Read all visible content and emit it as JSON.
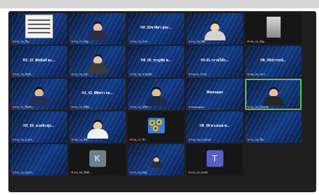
{
  "tiles": [
    {
      "name": "H3_10_student",
      "label": "H3_10_สื่อ...",
      "type": "picture"
    },
    {
      "name": "H3_07_student",
      "label": "H3_07_ณัฐ...",
      "type": "person",
      "skin": "#e7c0a2",
      "hair": "#1a1a1a",
      "shirt": "#2c2c44"
    },
    {
      "name": "H4_02_student",
      "label": "H4_02_ชาล...",
      "type": "name",
      "center": "H4_02ชาลิสา อุทะ..."
    },
    {
      "name": "H4_05_student",
      "label": "H4_05_ศศิ...",
      "type": "person",
      "skin": "#efd1bc",
      "hair": "#2b2018",
      "shirt": "#d8d2cc",
      "bg": "light"
    },
    {
      "name": "H6_05_student",
      "label": "H6_05_มัญ...",
      "type": "photo"
    },
    {
      "name": "H3_10b_student",
      "label": "H3_10_พัชนิ...",
      "type": "name",
      "center": "H3_10_พัชนันท์ ยะ..."
    },
    {
      "name": "H2_05_student",
      "label": "H2_05_สุภั...",
      "type": "person",
      "skin": "#e8c4a8",
      "hair": "#1f1f1f",
      "shirt": "#3b3b3b"
    },
    {
      "name": "H8_06_student",
      "label": "H8_06_ชาญชัย",
      "type": "name",
      "center": "H8_06_ชาญชัย พ..."
    },
    {
      "name": "H3_01_student",
      "label": "H3-01-วราพ...",
      "type": "name",
      "center": "H3-01-วราพโค้ก..."
    },
    {
      "name": "H6_09_student",
      "label": "H6_09_ปรา...",
      "type": "name",
      "center": "H6_09ปรารถน์..."
    },
    {
      "name": "H1_01_student",
      "label": "H1_01_ทีมหัว...",
      "type": "person",
      "skin": "#e3b894",
      "hair": "#101010",
      "shirt": "#22305a"
    },
    {
      "name": "H1_02_student",
      "label": "H1_02_ดิษิฐ...",
      "type": "name",
      "center": "H1_02_ดิษิทรา กอ..."
    },
    {
      "name": "H4_12_student",
      "label": "H4_12_สุริยา...",
      "type": "person",
      "skin": "#e5bd9c",
      "hair": "#121212",
      "shirt": "#1d2a48"
    },
    {
      "name": "Wannapai",
      "label": "Wannapai",
      "type": "name",
      "center": "Wannapai"
    },
    {
      "name": "H2_08_student",
      "label": "H2_08_ก้องภพ",
      "type": "person",
      "skin": "#e6bf9e",
      "hair": "#151515",
      "shirt": "#262626",
      "active": true
    },
    {
      "name": "H3_09_student",
      "label": "H3_09_นวลจ...",
      "type": "name",
      "center": "H3_09_นวลจัง ศุภ..."
    },
    {
      "name": "H5_04_student",
      "label": "H5_04_ธิติ...",
      "type": "person",
      "skin": "#e9c6a9",
      "hair": "#141414",
      "shirt": "#f2f2f2"
    },
    {
      "name": "H4_07_student",
      "label": "H4_07_จิร...",
      "type": "sunflower"
    },
    {
      "name": "H5_08_student",
      "label": "H5_08_ดวงกมล",
      "type": "name",
      "center": "H5_08 ดวงกมล พ..."
    },
    {
      "name": "H1_08_student",
      "label": "H1_08_ชื่อ...",
      "type": "blank"
    },
    {
      "name": "H2_12_student",
      "label": "H2_12_อุนนา...",
      "type": "blank"
    },
    {
      "name": "K_user",
      "label": "H4_09_กิตติ...",
      "type": "avatar",
      "initial": "K",
      "color": "#6f7f8a"
    },
    {
      "name": "H7_03_student",
      "label": "H7_03_ณัฐ...",
      "type": "person",
      "skin": "#e4bf9f",
      "hair": "#151515",
      "shirt": "#2a2a3a",
      "small": true
    },
    {
      "name": "T_user",
      "label": "H3_04_ธนพร",
      "type": "avatar",
      "initial": "T",
      "color": "#5a5fc7"
    }
  ]
}
